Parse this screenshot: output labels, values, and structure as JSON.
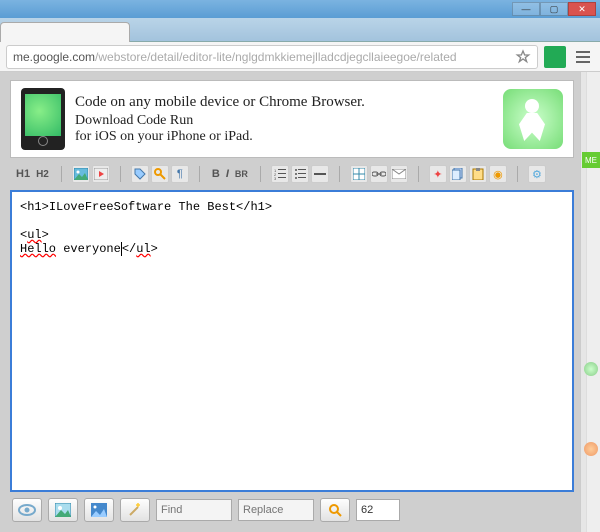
{
  "window": {
    "min": "—",
    "max": "▢",
    "close": "✕"
  },
  "url": {
    "host": "me.google.com",
    "path": "/webstore/detail/editor-lite/nglgdmkkiemejlladcdjegcllaieegoe/related"
  },
  "banner": {
    "line1": "Code on any mobile device or Chrome Browser.",
    "line2": "Download Code Run",
    "line3": "for iOS on your iPhone or iPad."
  },
  "toolbar": {
    "h1": "H1",
    "h2": "H2",
    "bold": "B",
    "italic": "I",
    "br": "BR"
  },
  "editor": {
    "tag_open_h1": "<h1>",
    "text1": "ILoveFreeSoftware The Best",
    "tag_close_h1": "</h1>",
    "tag_open_ul": "<ul>",
    "text2_a": "Hello",
    "text2_b": " everyone",
    "tag_close_ul": "</ul>"
  },
  "bottom": {
    "find_placeholder": "Find",
    "replace_placeholder": "Replace",
    "count": "62"
  },
  "sidebar": {
    "tag": "ME"
  }
}
